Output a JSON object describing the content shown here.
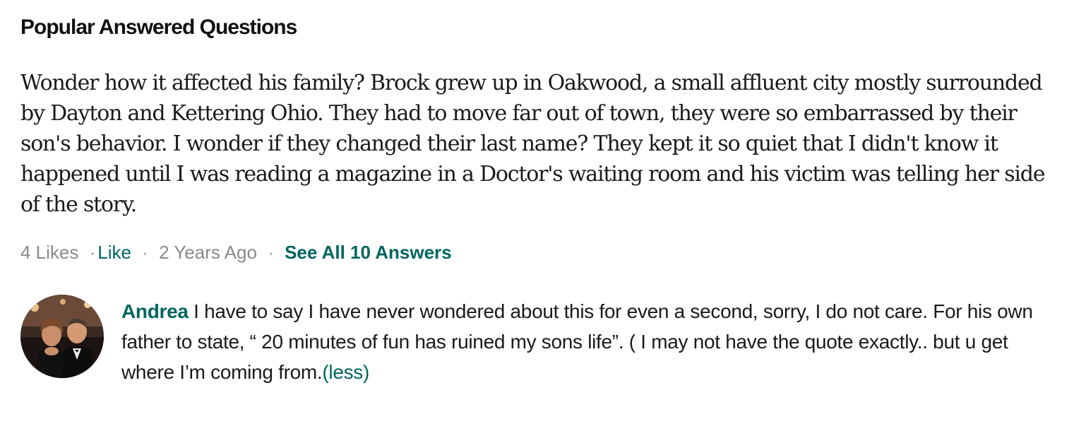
{
  "section": {
    "heading": "Popular Answered Questions"
  },
  "question": {
    "text": "Wonder how it affected his family? Brock grew up in Oakwood, a small affluent city mostly surrounded by Dayton and Kettering Ohio. They had to move far out of town, they were so embarrassed by their son's behavior. I wonder if they changed their last name? They kept it so quiet that I didn't know it happened until I was reading a magazine in a Doctor's waiting room and his victim was telling her side of the story.",
    "likes": "4 Likes",
    "like_label": "Like",
    "age": "2 Years Ago",
    "see_all_label": "See All 10 Answers",
    "separator": "·"
  },
  "answer": {
    "author": "Andrea",
    "text": "I have to say I have never wondered about this for even a second, sorry, I do not care. For his own father to state, “ 20 minutes of fun has ruined my sons life”. ( I may not have the quote exactly.. but u get where I’m coming from.",
    "less_label": "(less)"
  },
  "colors": {
    "accent": "#00665f",
    "muted_text": "#8a8a8a",
    "body_text": "#1a1a1a"
  }
}
